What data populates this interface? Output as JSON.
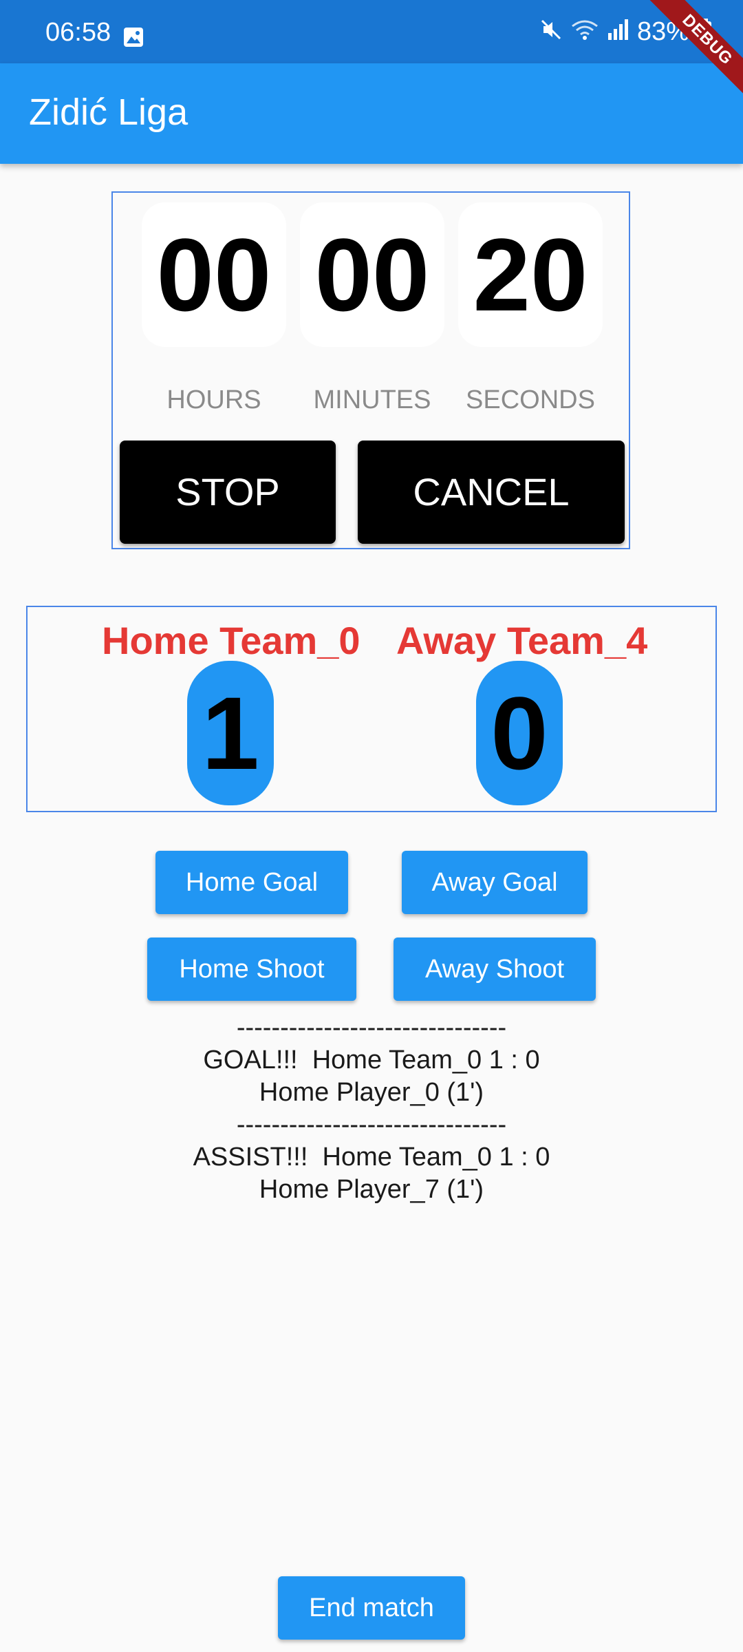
{
  "status_bar": {
    "time": "06:58",
    "battery_percent": "83%",
    "icons": [
      "gallery-icon",
      "mute-icon",
      "wifi-icon",
      "signal-icon",
      "battery-icon"
    ]
  },
  "debug_banner": "DEBUG",
  "app_bar": {
    "title": "Zidić Liga"
  },
  "timer": {
    "hours": "00",
    "minutes": "00",
    "seconds": "20",
    "labels": {
      "hours": "HOURS",
      "minutes": "MINUTES",
      "seconds": "SECONDS"
    },
    "stop_label": "STOP",
    "cancel_label": "CANCEL"
  },
  "scoreboard": {
    "home_team": "Home Team_0",
    "away_team": "Away Team_4",
    "home_score": "1",
    "away_score": "0"
  },
  "actions": {
    "home_goal": "Home Goal",
    "away_goal": "Away Goal",
    "home_shoot": "Home Shoot",
    "away_shoot": "Away Shoot"
  },
  "log": [
    "-------------------------------",
    "GOAL!!!  Home Team_0 1 : 0",
    "Home Player_0 (1')",
    "-------------------------------",
    "ASSIST!!!  Home Team_0 1 : 0",
    "Home Player_7 (1')"
  ],
  "end_match_label": "End match",
  "colors": {
    "status_bar": "#1976d2",
    "app_bar": "#2196f3",
    "team_name": "#e53935",
    "score_pill": "#2196f3",
    "debug_ribbon": "#a0181b"
  }
}
